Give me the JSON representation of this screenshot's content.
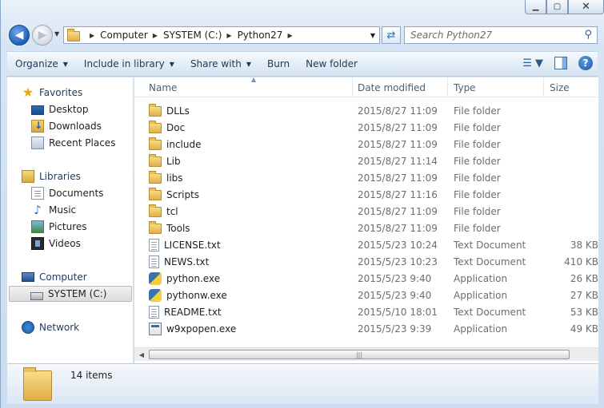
{
  "window": {
    "caption_buttons": {
      "minimize_icon": "minimize-icon",
      "maximize_icon": "maximize-icon",
      "close_icon": "close-icon"
    }
  },
  "address": {
    "crumbs": [
      "Computer",
      "SYSTEM (C:)",
      "Python27"
    ]
  },
  "search": {
    "placeholder": "Search Python27"
  },
  "toolbar": {
    "organize": "Organize",
    "include_in_library": "Include in library",
    "share_with": "Share with",
    "burn": "Burn",
    "new_folder": "New folder",
    "help": "?"
  },
  "nav": {
    "favorites": "Favorites",
    "desktop": "Desktop",
    "downloads": "Downloads",
    "recent_places": "Recent Places",
    "libraries": "Libraries",
    "documents": "Documents",
    "music": "Music",
    "pictures": "Pictures",
    "videos": "Videos",
    "computer": "Computer",
    "system_drive": "SYSTEM (C:)",
    "network": "Network"
  },
  "columns": {
    "name": "Name",
    "date_modified": "Date modified",
    "type": "Type",
    "size": "Size"
  },
  "files": [
    {
      "name": "DLLs",
      "date": "2015/8/27 11:09",
      "type": "File folder",
      "size": "",
      "icon": "folder"
    },
    {
      "name": "Doc",
      "date": "2015/8/27 11:09",
      "type": "File folder",
      "size": "",
      "icon": "folder"
    },
    {
      "name": "include",
      "date": "2015/8/27 11:09",
      "type": "File folder",
      "size": "",
      "icon": "folder"
    },
    {
      "name": "Lib",
      "date": "2015/8/27 11:14",
      "type": "File folder",
      "size": "",
      "icon": "folder"
    },
    {
      "name": "libs",
      "date": "2015/8/27 11:09",
      "type": "File folder",
      "size": "",
      "icon": "folder"
    },
    {
      "name": "Scripts",
      "date": "2015/8/27 11:16",
      "type": "File folder",
      "size": "",
      "icon": "folder"
    },
    {
      "name": "tcl",
      "date": "2015/8/27 11:09",
      "type": "File folder",
      "size": "",
      "icon": "folder"
    },
    {
      "name": "Tools",
      "date": "2015/8/27 11:09",
      "type": "File folder",
      "size": "",
      "icon": "folder"
    },
    {
      "name": "LICENSE.txt",
      "date": "2015/5/23 10:24",
      "type": "Text Document",
      "size": "38 KB",
      "icon": "text"
    },
    {
      "name": "NEWS.txt",
      "date": "2015/5/23 10:23",
      "type": "Text Document",
      "size": "410 KB",
      "icon": "text"
    },
    {
      "name": "python.exe",
      "date": "2015/5/23 9:40",
      "type": "Application",
      "size": "26 KB",
      "icon": "python"
    },
    {
      "name": "pythonw.exe",
      "date": "2015/5/23 9:40",
      "type": "Application",
      "size": "27 KB",
      "icon": "python"
    },
    {
      "name": "README.txt",
      "date": "2015/5/10 18:01",
      "type": "Text Document",
      "size": "53 KB",
      "icon": "text"
    },
    {
      "name": "w9xpopen.exe",
      "date": "2015/5/23 9:39",
      "type": "Application",
      "size": "49 KB",
      "icon": "exe"
    }
  ],
  "status": {
    "item_count": "14 items"
  }
}
